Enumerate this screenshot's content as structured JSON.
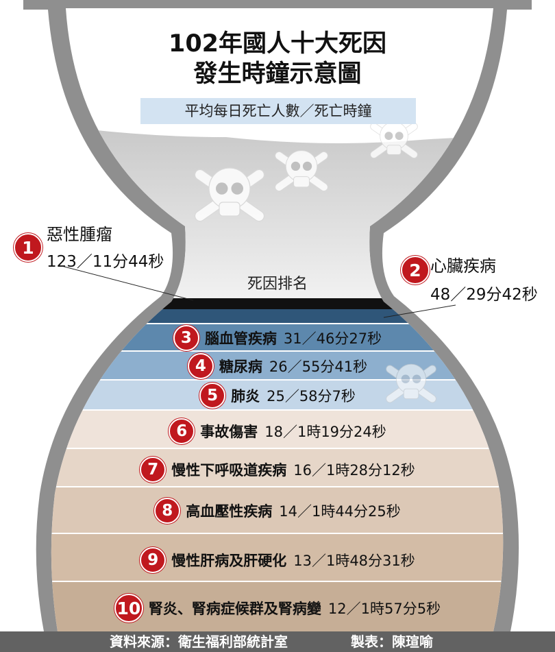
{
  "title": {
    "line1": "102年國人十大死因",
    "line2": "發生時鐘示意圖"
  },
  "subtitle": "平均每日死亡人數／死亡時鐘",
  "rank_label": "死因排名",
  "causes": [
    {
      "rank": "1",
      "name": "惡性腫瘤",
      "stat": "123／11分44秒"
    },
    {
      "rank": "2",
      "name": "心臟疾病",
      "stat": "48／29分42秒"
    },
    {
      "rank": "3",
      "name": "腦血管疾病",
      "stat": "31／46分27秒"
    },
    {
      "rank": "4",
      "name": "糖尿病",
      "stat": "26／55分41秒"
    },
    {
      "rank": "5",
      "name": "肺炎",
      "stat": "25／58分7秒"
    },
    {
      "rank": "6",
      "name": "事故傷害",
      "stat": "18／1時19分24秒"
    },
    {
      "rank": "7",
      "name": "慢性下呼吸道疾病",
      "stat": "16／1時28分12秒"
    },
    {
      "rank": "8",
      "name": "高血壓性疾病",
      "stat": "14／1時44分25秒"
    },
    {
      "rank": "9",
      "name": "慢性肝病及肝硬化",
      "stat": "13／1時48分31秒"
    },
    {
      "rank": "10",
      "name": "腎炎、腎病症候群及腎病變",
      "stat": "12／1時57分5秒"
    }
  ],
  "footer": {
    "source": "資料來源：衛生福利部統計室",
    "credit": "製表：陳瑄喻"
  },
  "icons": [
    "skull-crossbones-icon"
  ],
  "colors": {
    "badge": "#c0181e",
    "frame": "#8e8e8e",
    "blue_band": "#5f87ab",
    "beige_band": "#c9b19a",
    "footer": "#626262"
  }
}
